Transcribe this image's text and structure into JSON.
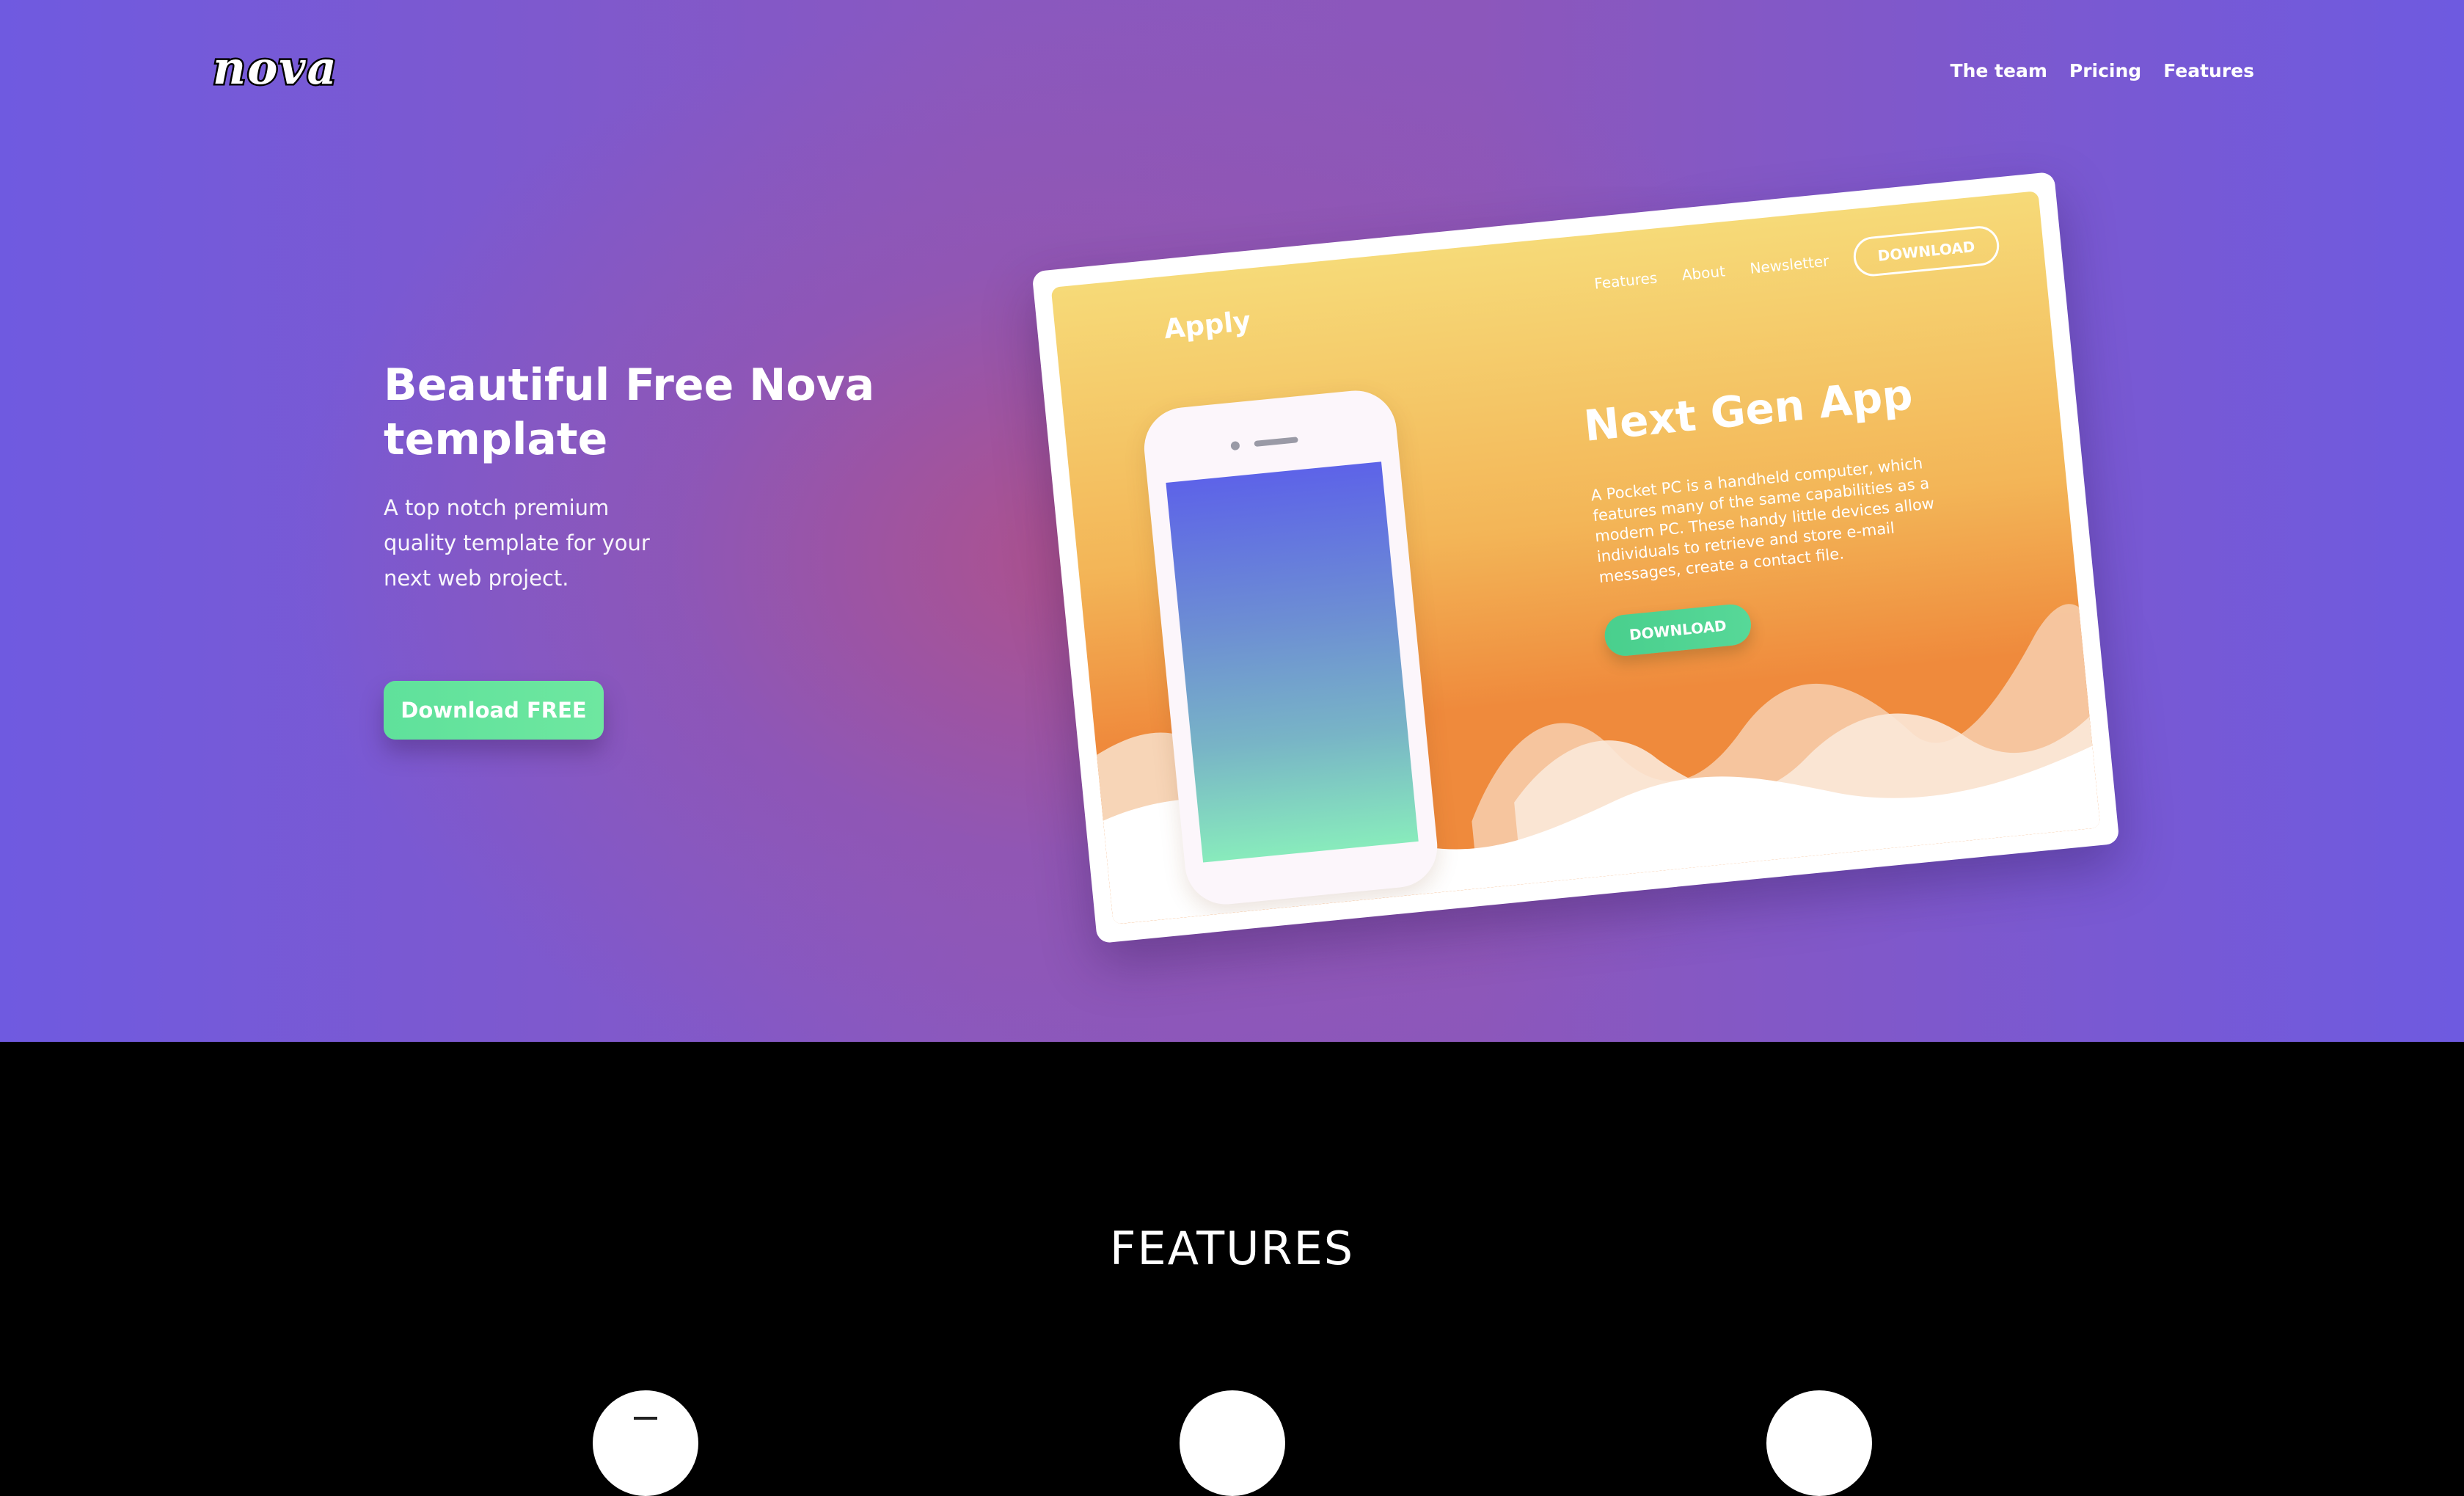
{
  "header": {
    "logo": "nova",
    "nav": [
      "The team",
      "Pricing",
      "Features"
    ]
  },
  "hero": {
    "title": "Beautiful Free Nova template",
    "subtitle": "A top notch premium quality template for your next web project.",
    "cta_label": "Download FREE"
  },
  "mockup": {
    "brand": "Apply",
    "nav": [
      "Features",
      "About",
      "Newsletter"
    ],
    "nav_cta": "DOWNLOAD",
    "heading": "Next Gen App",
    "description": "A Pocket PC is a handheld computer, which features many of the same capabilities as a modern PC. These handy little devices allow individuals to retrieve and store e-mail messages, create a contact file.",
    "button": "DOWNLOAD"
  },
  "features": {
    "title": "FEATURES"
  },
  "colors": {
    "hero_gradient_start": "#6f5ae0",
    "hero_gradient_center": "#b55082",
    "cta_green": "#5fe19b",
    "mockup_yellow": "#f6da78",
    "mockup_orange": "#ef8a3c",
    "features_bg": "#000000"
  }
}
